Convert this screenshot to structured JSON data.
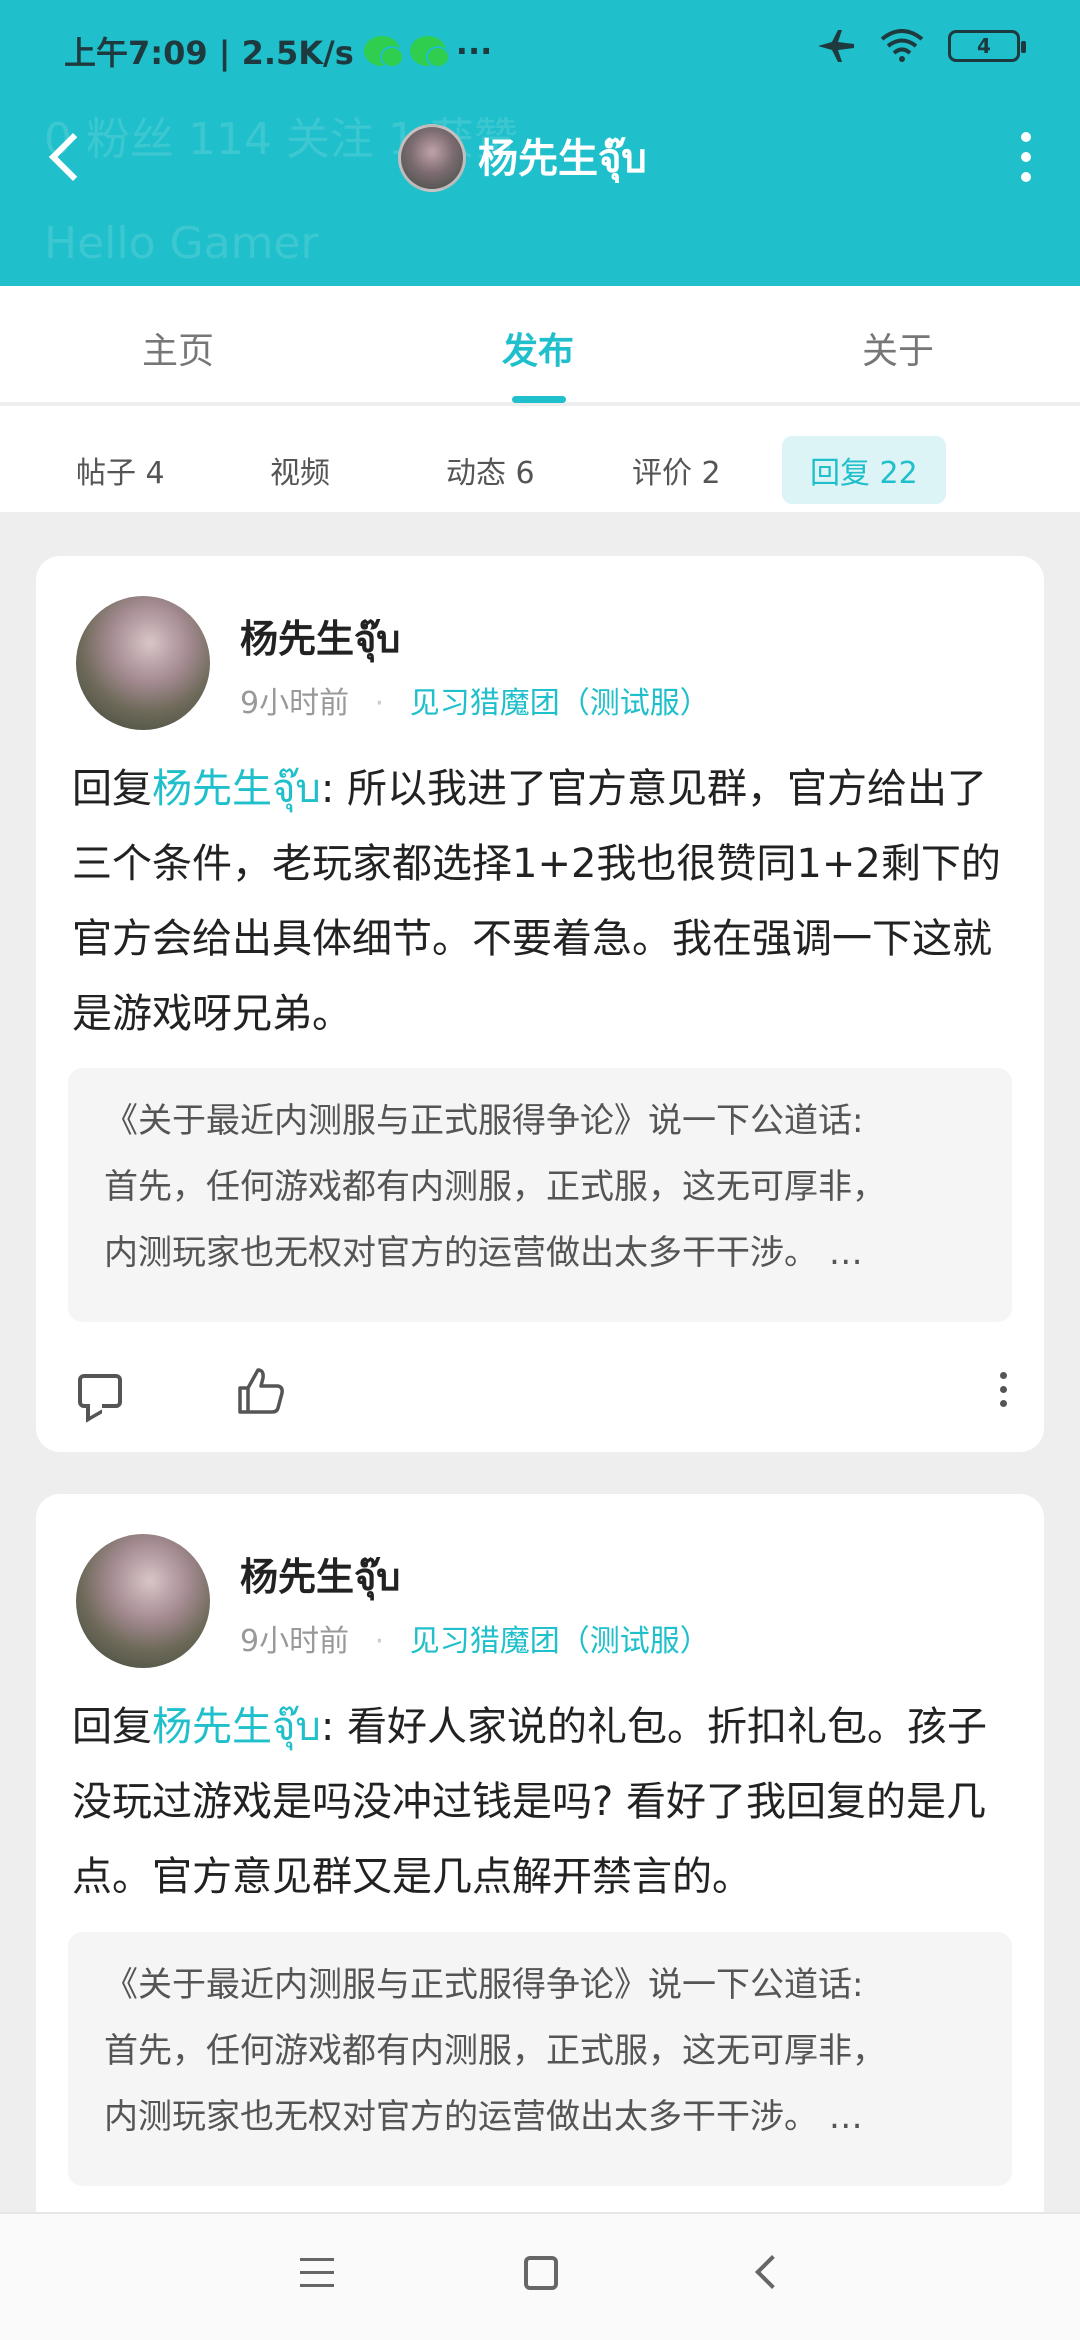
{
  "status_bar": {
    "time_speed": "上午7:09 | 2.5K/s",
    "more": "···",
    "battery": "4"
  },
  "header": {
    "ghost_text": "0 粉丝  114 关注  1 获赞",
    "ghost_sub": "Hello Gamer",
    "title": "杨先生จุ๊บ"
  },
  "tabs": [
    {
      "label": "主页"
    },
    {
      "label": "发布"
    },
    {
      "label": "关于"
    }
  ],
  "subtabs": [
    {
      "label": "帖子 4"
    },
    {
      "label": "视频"
    },
    {
      "label": "动态 6"
    },
    {
      "label": "评价 2"
    },
    {
      "label": "回复 22"
    }
  ],
  "posts": [
    {
      "author": "杨先生จุ๊บ",
      "time": "9小时前",
      "separator": "·",
      "game": "见习猎魔团（测试服）",
      "reply_prefix": "回复",
      "mention": "杨先生จุ๊บ",
      "body": ": 所以我进了官方意见群，官方给出了三个条件，老玩家都选择1+2我也很赞同1+2剩下的官方会给出具体细节。不要着急。我在强调一下这就是游戏呀兄弟。",
      "quote_lines": [
        "《关于最近内测服与正式服得争论》说一下公道话:",
        "首先，任何游戏都有内测服，正式服，这无可厚非，",
        "内测玩家也无权对官方的运营做出太多干干涉。 …"
      ]
    },
    {
      "author": "杨先生จุ๊บ",
      "time": "9小时前",
      "separator": "·",
      "game": "见习猎魔团（测试服）",
      "reply_prefix": "回复",
      "mention": "杨先生จุ๊บ",
      "body": ": 看好人家说的礼包。折扣礼包。孩子没玩过游戏是吗没冲过钱是吗? 看好了我回复的是几点。官方意见群又是几点解开禁言的。",
      "quote_lines": [
        "《关于最近内测服与正式服得争论》说一下公道话:",
        "首先，任何游戏都有内测服，正式服，这无可厚非，",
        "内测玩家也无权对官方的运营做出太多干干涉。 …"
      ]
    }
  ],
  "colors": {
    "accent": "#1fbfcb",
    "background": "#eeeeee"
  }
}
